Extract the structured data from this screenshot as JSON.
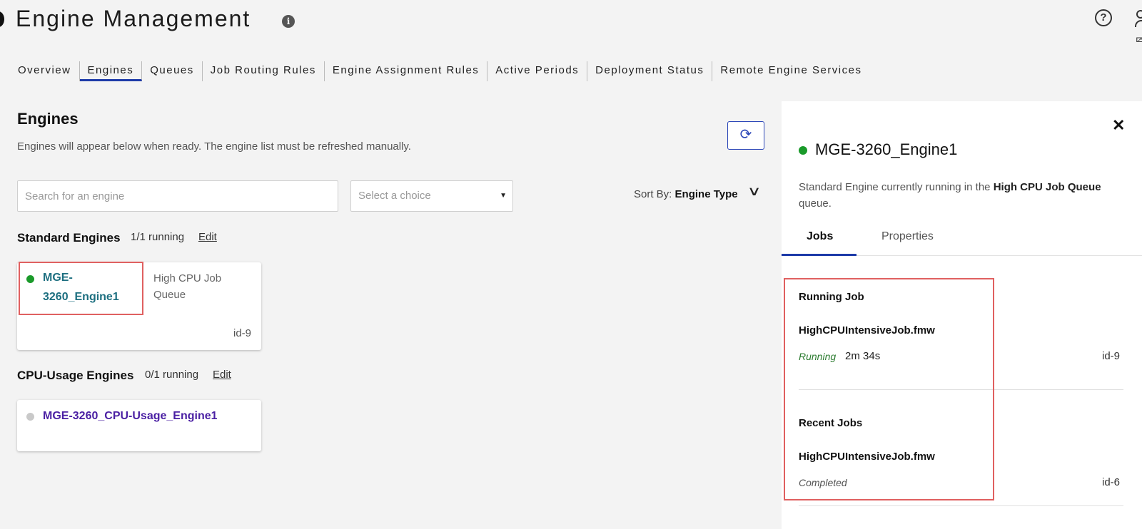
{
  "header": {
    "title": "Engine Management",
    "info_icon": "i",
    "help_icon": "?"
  },
  "tabs": [
    {
      "label": "Overview",
      "active": false
    },
    {
      "label": "Engines",
      "active": true
    },
    {
      "label": "Queues",
      "active": false
    },
    {
      "label": "Job Routing Rules",
      "active": false
    },
    {
      "label": "Engine Assignment Rules",
      "active": false
    },
    {
      "label": "Active Periods",
      "active": false
    },
    {
      "label": "Deployment Status",
      "active": false
    },
    {
      "label": "Remote Engine Services",
      "active": false
    }
  ],
  "engines": {
    "title": "Engines",
    "description": "Engines will appear below when ready. The engine list must be refreshed manually.",
    "search_placeholder": "Search for an engine",
    "select_placeholder": "Select a choice",
    "sort_label": "Sort By:",
    "sort_value": "Engine Type"
  },
  "groups": {
    "standard": {
      "title": "Standard Engines",
      "count": "1/1 running",
      "edit": "Edit",
      "engine": {
        "name_line1": "MGE-",
        "name_line2": "3260_Engine1",
        "queue_line1": "High CPU Job",
        "queue_line2": "Queue",
        "id": "id-9",
        "status_color": "#1a9a2a",
        "name_color": "#1d6f80"
      }
    },
    "cpu_usage": {
      "title": "CPU-Usage Engines",
      "count": "0/1 running",
      "edit": "Edit",
      "engine": {
        "name": "MGE-3260_CPU-Usage_Engine1",
        "status_color": "#c9c9c9",
        "name_color": "#4a1fa3"
      }
    }
  },
  "panel": {
    "engine_name": "MGE-3260_Engine1",
    "desc_prefix": "Standard Engine currently running in the ",
    "desc_queue": "High CPU Job Queue",
    "desc_suffix": "queue.",
    "tabs": {
      "jobs": "Jobs",
      "properties": "Properties"
    },
    "running": {
      "heading": "Running Job",
      "file": "HighCPUIntensiveJob.fmw",
      "status": "Running",
      "duration": "2m 34s",
      "id": "id-9",
      "status_color": "#2e7d32"
    },
    "recent": {
      "heading": "Recent Jobs",
      "file": "HighCPUIntensiveJob.fmw",
      "status": "Completed",
      "id": "id-6",
      "status_color": "#555555"
    }
  }
}
